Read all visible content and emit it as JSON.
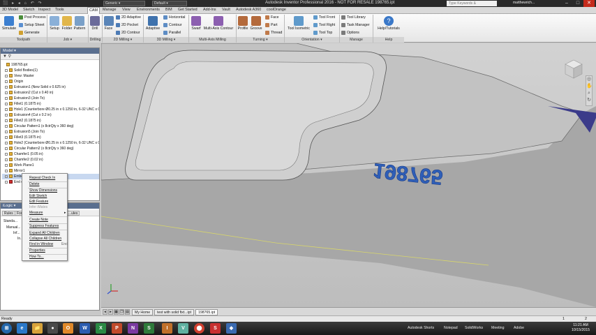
{
  "window": {
    "title": "Autodesk Inventor Professional 2016 - NOT FOR RESALE   198765.ipt",
    "material": "Generic",
    "appearance": "Default",
    "search_placeholder": "Type Keywords & Commands...",
    "user": "matthewrich...",
    "minimize": "–",
    "maximize": "□",
    "close": "✕"
  },
  "ribbon_tabs": [
    "3D Model",
    "Sketch",
    "Inspect",
    "Tools",
    "CAM",
    "Manage",
    "View",
    "Environments",
    "BIM",
    "Get Started",
    "Add-Ins",
    "Vault",
    "Autodesk A360",
    "coolOrange"
  ],
  "ribbon": {
    "simulate": "Simulate",
    "post_process": "Post Process",
    "setup_sheet": "Setup Sheet",
    "generate": "Generate",
    "setup": "Setup",
    "folder": "Folder",
    "pattern": "Pattern",
    "drill": "Drill",
    "face": "Face",
    "adaptive_2d": "2D Adaptive",
    "pocket_2d": "2D Pocket",
    "contour_2d": "2D Contour",
    "adaptive": "Adaptive",
    "horizontal": "Horizontal",
    "contour": "Contour",
    "parallel": "Parallel",
    "swarf": "Swarf",
    "multi_axis_contour": "Multi-Axis Contour",
    "profile": "Profile",
    "groove": "Groove",
    "t_face": "Face",
    "t_part": "Part",
    "t_thread": "Thread",
    "tool_isometric": "Tool Isometric",
    "tool_front": "Tool Front",
    "tool_right": "Tool Right",
    "tool_top": "Tool Top",
    "tool_library": "Tool Library",
    "task_manager": "Task Manager",
    "options": "Options",
    "help": "Help/Tutorials",
    "groups": {
      "toolpath": "Toolpath",
      "job": "Job ▾",
      "drilling": "Drilling",
      "milling_2d": "2D Milling ▾",
      "milling_3d": "3D Milling ▾",
      "multi_axis": "Multi-Axis Milling",
      "turning": "Turning ▾",
      "orientation": "Orientation ▾",
      "manage": "Manage",
      "help": "Help"
    }
  },
  "model_panel": {
    "title": "Model ▾",
    "tools": "▼  ⚲",
    "tree": [
      "198765.ipt",
      "Solid Bodies(1)",
      "View: Master",
      "Origin",
      "Extrusion1 (New Solid x 0.625 in)",
      "Extrusion2 (Cut x 0.40 in)",
      "Extrusion3 (Join To)",
      "Fillet1 (0.1875 in)",
      "Hole1 (Counterbore Ø0.25 in x 0.1250 in, 6-32 UNC x 0.2",
      "Extrusion4 (Cut x 0.2 in)",
      "Fillet2 (0.1875 in)",
      "Circular Pattern1 (x 8ctrQty x 360 deg)",
      "Extrusion5 (Join To)",
      "Fillet3 (0.1875 in)",
      "Hole2 (Counterbore Ø0.25 in x 0.1250 in, 6-32 UNC x 0.2",
      "Circular Pattern2 (x 8ctrQty x 360 deg)",
      "Chamfer1 (0.05 in)",
      "Chamfer2 (0.02 in)",
      "Work Plane1",
      "Mirror1",
      "Emboss1",
      "End of Part"
    ]
  },
  "context_menu": {
    "items": [
      "Repeat Check In",
      "Delete",
      "Show Dimensions",
      "Edit Sketch",
      "Edit Feature",
      "Infer iMates",
      "Measure",
      "Create Note",
      "Suppress Features",
      "Expand All Children",
      "Collapse All Children",
      "Find in Window",
      "Properties",
      "How To..."
    ],
    "find_shortcut": "End",
    "measure_arrow": "▸"
  },
  "ilogic_panel": {
    "title": "iLogic ▾",
    "tabs": [
      "Rules",
      "Forms",
      "Global Forms",
      "Ex...",
      "...ules"
    ],
    "rows": [
      "Standa...",
      "Manual...",
      "Inf...",
      "In..."
    ]
  },
  "embossed_text": "198765",
  "doc_tabs": [
    "My Home",
    "test with solid fixt...ipt",
    "198765.ipt"
  ],
  "status": {
    "left": "Ready",
    "page_a": "1",
    "page_b": "2"
  },
  "taskbar": {
    "start": "⊞",
    "apps": [
      "e",
      "📁",
      "●",
      "O",
      "W",
      "X",
      "P",
      "N",
      "S",
      "I",
      "V",
      "⬤",
      "S",
      "◆"
    ],
    "items": [
      "Autodesk Shorts",
      "Notepad",
      "SolidWorks",
      "Meeting",
      "Adobe"
    ],
    "time": "11:21 AM",
    "date": "10/15/2015"
  }
}
